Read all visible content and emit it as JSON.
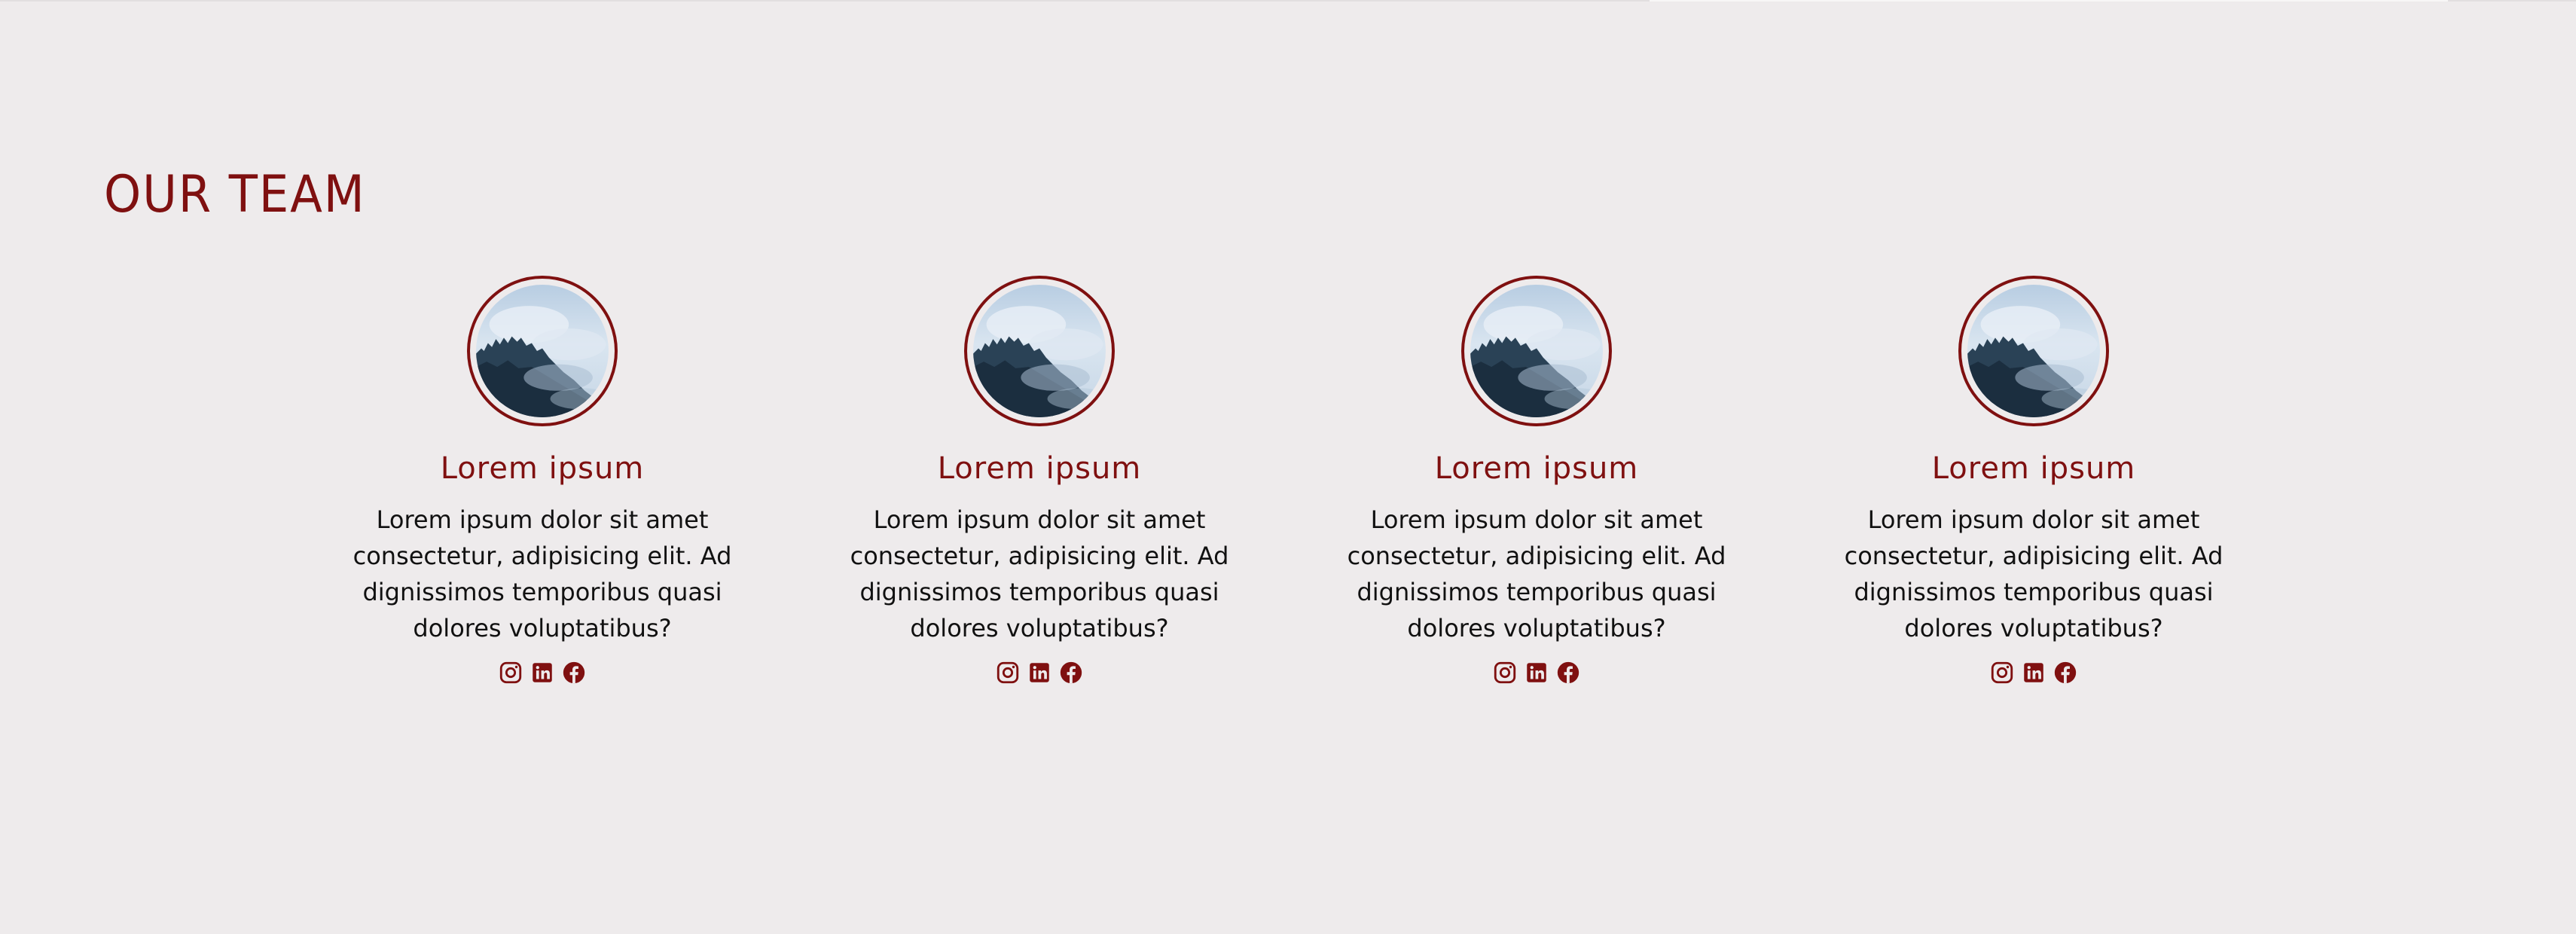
{
  "section": {
    "title": "OUR TEAM"
  },
  "colors": {
    "accent": "#7f1010",
    "background": "#eeebec",
    "text": "#111111"
  },
  "members": [
    {
      "name": "Lorem ipsum",
      "bio": "Lorem ipsum dolor sit amet consectetur, adipisicing elit. Ad dignissimos temporibus quasi dolores voluptatibus?",
      "socials": [
        "instagram-icon",
        "linkedin-icon",
        "facebook-icon"
      ]
    },
    {
      "name": "Lorem ipsum",
      "bio": "Lorem ipsum dolor sit amet consectetur, adipisicing elit. Ad dignissimos temporibus quasi dolores voluptatibus?",
      "socials": [
        "instagram-icon",
        "linkedin-icon",
        "facebook-icon"
      ]
    },
    {
      "name": "Lorem ipsum",
      "bio": "Lorem ipsum dolor sit amet consectetur, adipisicing elit. Ad dignissimos temporibus quasi dolores voluptatibus?",
      "socials": [
        "instagram-icon",
        "linkedin-icon",
        "facebook-icon"
      ]
    },
    {
      "name": "Lorem ipsum",
      "bio": "Lorem ipsum dolor sit amet consectetur, adipisicing elit. Ad dignissimos temporibus quasi dolores voluptatibus?",
      "socials": [
        "instagram-icon",
        "linkedin-icon",
        "facebook-icon"
      ]
    }
  ]
}
